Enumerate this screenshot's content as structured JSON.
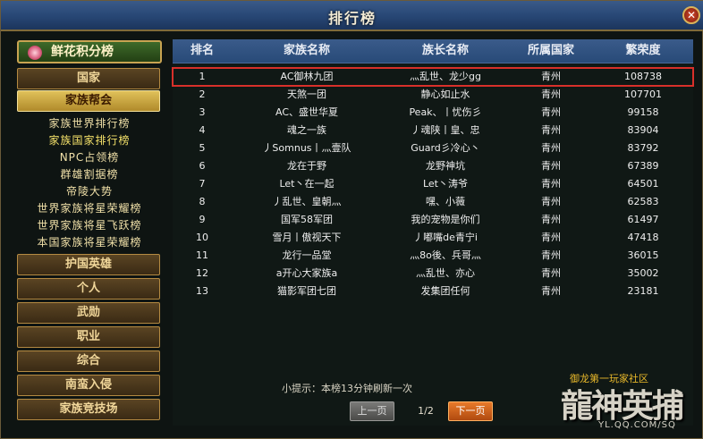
{
  "window": {
    "title": "排行榜",
    "close_label": "✕"
  },
  "sidebar": {
    "top": "鲜花积分榜",
    "main": [
      {
        "label": "国家",
        "active": false
      },
      {
        "label": "家族帮会",
        "active": true
      },
      {
        "label": "护国英雄",
        "active": false
      },
      {
        "label": "个人",
        "active": false
      },
      {
        "label": "武勋",
        "active": false
      },
      {
        "label": "职业",
        "active": false
      },
      {
        "label": "综合",
        "active": false
      },
      {
        "label": "南蛮入侵",
        "active": false
      },
      {
        "label": "家族竞技场",
        "active": false
      }
    ],
    "sub": [
      {
        "label": "家族世界排行榜"
      },
      {
        "label": "家族国家排行榜"
      },
      {
        "label": "NPC占领榜"
      },
      {
        "label": "群雄割据榜"
      },
      {
        "label": "帝陵大势"
      },
      {
        "label": "世界家族将星荣耀榜"
      },
      {
        "label": "世界家族将星飞跃榜"
      },
      {
        "label": "本国家族将星荣耀榜"
      }
    ]
  },
  "table": {
    "headers": [
      "排名",
      "家族名称",
      "族长名称",
      "所属国家",
      "繁荣度"
    ],
    "rows": [
      [
        "1",
        "AC御林九团",
        "灬乱世、龙少gg",
        "青州",
        "108738"
      ],
      [
        "2",
        "天煞一团",
        "静心如止水",
        "青州",
        "107701"
      ],
      [
        "3",
        "AC、盛世华夏",
        "Peak、丨忧伤彡",
        "青州",
        "99158"
      ],
      [
        "4",
        "魂之一族",
        "丿魂陕丨皇、忠",
        "青州",
        "83904"
      ],
      [
        "5",
        "丿Somnus丨灬壹队",
        "Guard彡冷心丶",
        "青州",
        "83792"
      ],
      [
        "6",
        "龙在于野",
        "龙野神坑",
        "青州",
        "67389"
      ],
      [
        "7",
        "Let丶在一起",
        "Let丶涛爷",
        "青州",
        "64501"
      ],
      [
        "8",
        "丿乱世、皇朝灬",
        "嘿、小薇",
        "青州",
        "62583"
      ],
      [
        "9",
        "国军58军团",
        "我的宠物是你们",
        "青州",
        "61497"
      ],
      [
        "10",
        "雪月丨傲视天下",
        "丿嘟嘴de青宁i",
        "青州",
        "47418"
      ],
      [
        "11",
        "龙行一品堂",
        "灬8o後、兵哥灬",
        "青州",
        "36015"
      ],
      [
        "12",
        "a开心大家族a",
        "灬乱世、亦心",
        "青州",
        "35002"
      ],
      [
        "13",
        "猫影军团七团",
        "发集团任何",
        "青州",
        "23181"
      ]
    ]
  },
  "footer": {
    "hint": "小提示：本榜13分钟刷新一次",
    "prev": "上一页",
    "next": "下一页",
    "page": "1/2"
  },
  "logo": {
    "tag": "御龙第一玩家社区",
    "main": "龍神英捕",
    "url": "YL.QQ.COM/SQ"
  },
  "colors": {
    "accent": "#d8302a",
    "header": "#2c4f80",
    "gold": "#c8a452"
  }
}
